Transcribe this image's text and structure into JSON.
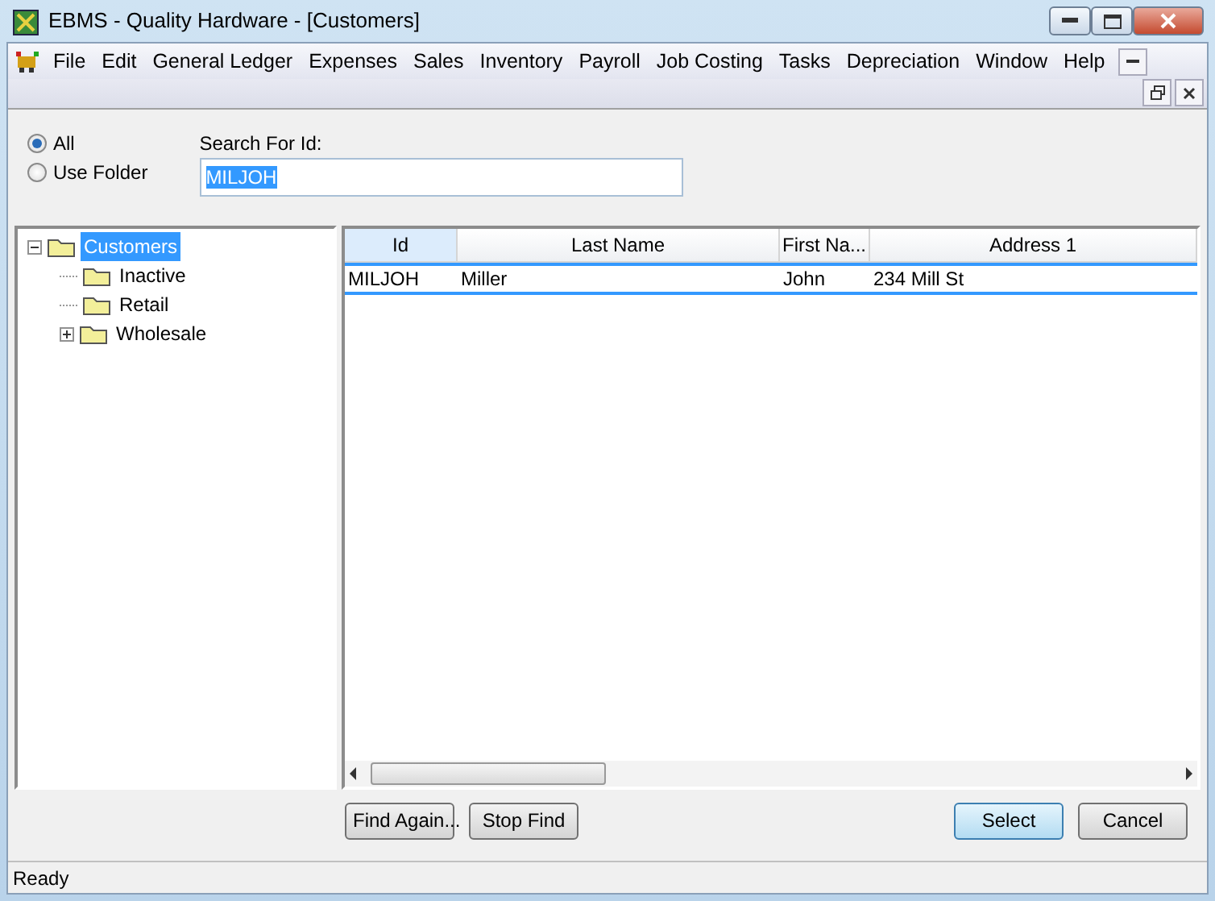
{
  "window": {
    "title": "EBMS - Quality Hardware - [Customers]"
  },
  "menu": [
    "File",
    "Edit",
    "General Ledger",
    "Expenses",
    "Sales",
    "Inventory",
    "Payroll",
    "Job Costing",
    "Tasks",
    "Depreciation",
    "Window",
    "Help"
  ],
  "scope": [
    {
      "label": "All",
      "selected": true
    },
    {
      "label": "Use Folder",
      "selected": false
    }
  ],
  "search": {
    "label": "Search For Id:",
    "value": "MILJOH"
  },
  "tree": [
    {
      "label": "Customers",
      "selected": true,
      "expanded": true,
      "children": [
        {
          "label": "Inactive",
          "selected": false
        },
        {
          "label": "Retail",
          "selected": false
        },
        {
          "label": "Wholesale",
          "selected": false,
          "expanded": false
        }
      ]
    }
  ],
  "table": {
    "columns": [
      "Id",
      "Last Name",
      "First Na...",
      "Address 1"
    ],
    "rows": [
      {
        "cells": [
          "MILJOH",
          "Miller",
          "John",
          "234 Mill St"
        ],
        "selected": true
      }
    ]
  },
  "buttons": [
    {
      "label": "Find Again...",
      "default": false
    },
    {
      "label": "Stop Find",
      "default": false
    },
    {
      "label": "Select",
      "default": true
    },
    {
      "label": "Cancel",
      "default": false
    }
  ],
  "status_bar": "Ready"
}
